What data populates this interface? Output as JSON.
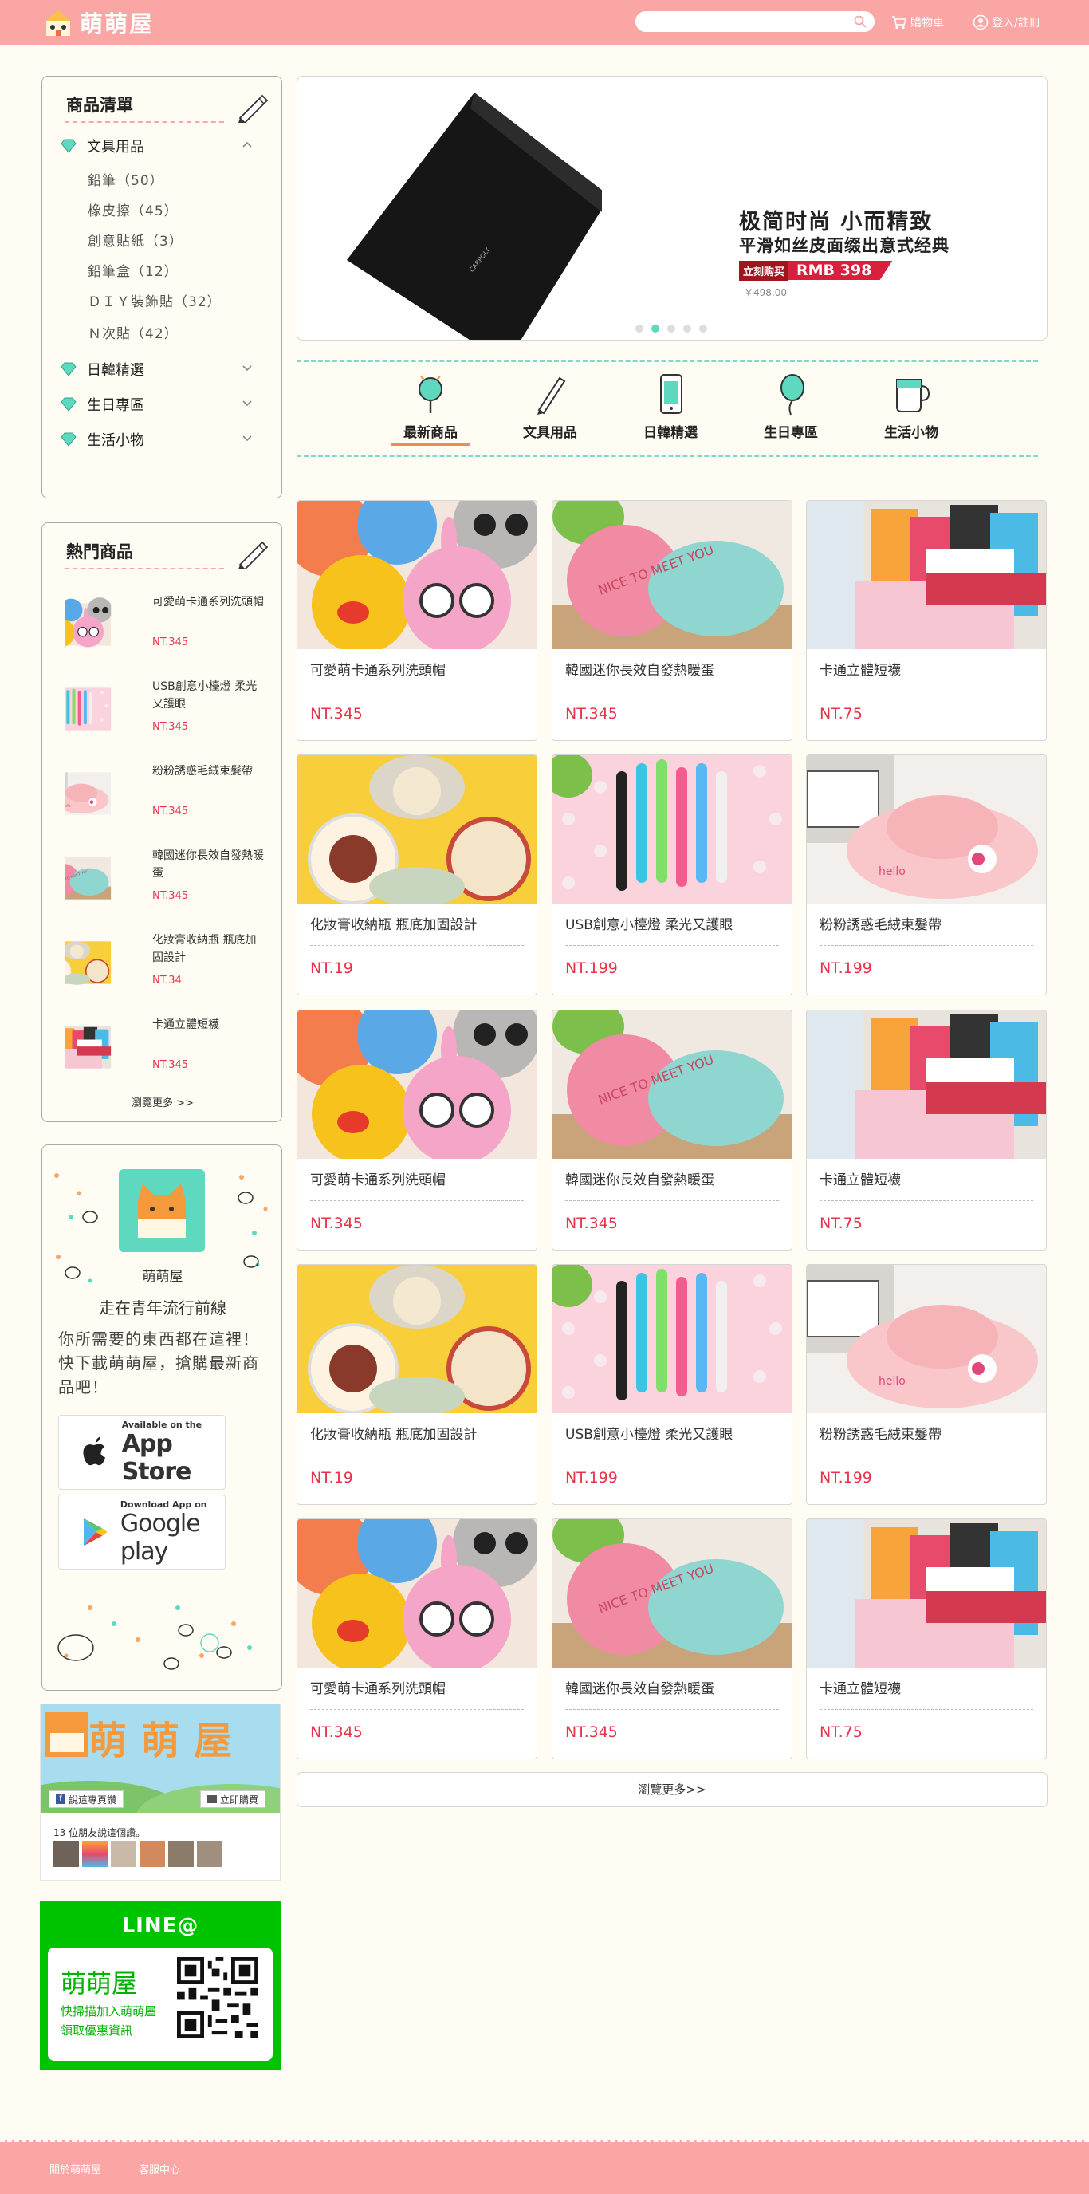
{
  "header": {
    "logo_text": "萌萌屋",
    "search_placeholder": "",
    "cart_label": "購物車",
    "login_label": "登入/註冊"
  },
  "sidebar": {
    "categories_title": "商品清單",
    "categories": [
      {
        "label": "文具用品",
        "expanded": true,
        "children": [
          "鉛筆（50）",
          "橡皮擦（45）",
          "創意貼紙（3）",
          "鉛筆盒（12）",
          "ＤＩＹ裝飾貼（32）",
          "Ｎ次貼（42）"
        ]
      },
      {
        "label": "日韓精選",
        "expanded": false
      },
      {
        "label": "生日專區",
        "expanded": false
      },
      {
        "label": "生活小物",
        "expanded": false
      }
    ],
    "hot_title": "熱門商品",
    "hot_items": [
      {
        "name": "可愛萌卡通系列洗頭帽",
        "price": "NT.345",
        "img": "hat"
      },
      {
        "name": "USB創意小檯燈 柔光又護眼",
        "price": "NT.345",
        "img": "usb"
      },
      {
        "name": "粉粉誘惑毛絨束髮帶",
        "price": "NT.345",
        "img": "band"
      },
      {
        "name": "韓國迷你長效自發熱暖蛋",
        "price": "NT.345",
        "img": "egg"
      },
      {
        "name": "化妝膏收納瓶 瓶底加固設計",
        "price": "NT.34",
        "img": "jar"
      },
      {
        "name": "卡通立體短襪",
        "price": "NT.345",
        "img": "socks"
      }
    ],
    "hot_more": "瀏覽更多 >>",
    "app": {
      "name": "萌萌屋",
      "slogan": "走在青年流行前線",
      "desc": "你所需要的東西都在這裡！快下載萌萌屋，搶購最新商品吧！",
      "appstore_small": "Available on the",
      "appstore_big": "App Store",
      "googleplay_small": "Download App on",
      "googleplay_big": "Google play"
    },
    "facebook": {
      "banner_text": "萌萌屋",
      "like_label": "說這專頁讚",
      "shop_label": "立即購買",
      "friends_text": "13 位朋友說這個讚。"
    },
    "line": {
      "title": "LINE@",
      "name": "萌萌屋",
      "desc": "快掃描加入萌萌屋領取優惠資訊"
    }
  },
  "banner": {
    "headline": "极简时尚 小而精致",
    "subline": "平滑如丝皮面缀出意式经典",
    "buy_tag": "立刻购买",
    "price": "RMB 398",
    "old_price": "￥498.00",
    "slide_count": 5,
    "active_slide": 2
  },
  "category_nav": [
    {
      "label": "最新商品",
      "icon": "magnifier-icon",
      "active": true
    },
    {
      "label": "文具用品",
      "icon": "pencil-icon",
      "active": false
    },
    {
      "label": "日韓精選",
      "icon": "phone-icon",
      "active": false
    },
    {
      "label": "生日專區",
      "icon": "balloon-icon",
      "active": false
    },
    {
      "label": "生活小物",
      "icon": "cup-icon",
      "active": false
    }
  ],
  "products": [
    {
      "name": "可愛萌卡通系列洗頭帽",
      "price": "NT.345",
      "img": "hat"
    },
    {
      "name": "韓國迷你長效自發熱暖蛋",
      "price": "NT.345",
      "img": "egg"
    },
    {
      "name": "卡通立體短襪",
      "price": "NT.75",
      "img": "socks"
    },
    {
      "name": "化妝膏收納瓶 瓶底加固設計",
      "price": "NT.19",
      "img": "jar"
    },
    {
      "name": "USB創意小檯燈 柔光又護眼",
      "price": "NT.199",
      "img": "usb"
    },
    {
      "name": "粉粉誘惑毛絨束髮帶",
      "price": "NT.199",
      "img": "band"
    },
    {
      "name": "可愛萌卡通系列洗頭帽",
      "price": "NT.345",
      "img": "hat"
    },
    {
      "name": "韓國迷你長效自發熱暖蛋",
      "price": "NT.345",
      "img": "egg"
    },
    {
      "name": "卡通立體短襪",
      "price": "NT.75",
      "img": "socks"
    },
    {
      "name": "化妝膏收納瓶 瓶底加固設計",
      "price": "NT.19",
      "img": "jar"
    },
    {
      "name": "USB創意小檯燈 柔光又護眼",
      "price": "NT.199",
      "img": "usb"
    },
    {
      "name": "粉粉誘惑毛絨束髮帶",
      "price": "NT.199",
      "img": "band"
    },
    {
      "name": "可愛萌卡通系列洗頭帽",
      "price": "NT.345",
      "img": "hat"
    },
    {
      "name": "韓國迷你長效自發熱暖蛋",
      "price": "NT.345",
      "img": "egg"
    },
    {
      "name": "卡通立體短襪",
      "price": "NT.75",
      "img": "socks"
    }
  ],
  "more_button": "瀏覽更多>>",
  "footer": {
    "about": "關於萌萌屋",
    "service": "客服中心"
  },
  "colors": {
    "brand_pink": "#f9a6a4",
    "accent_mint": "#7fd9c6",
    "price_red": "#e8334a",
    "line_green": "#00c300"
  }
}
